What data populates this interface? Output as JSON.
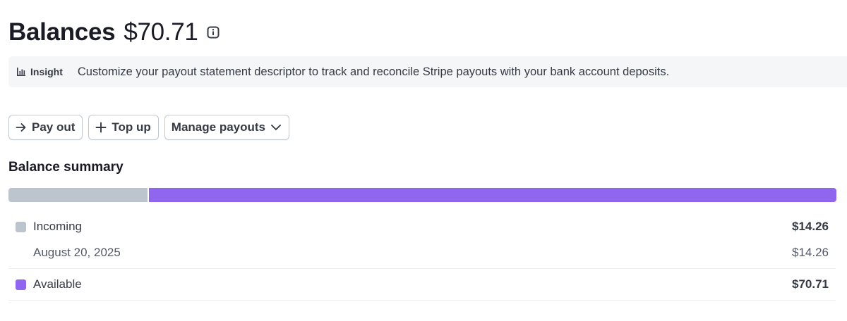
{
  "header": {
    "title": "Balances",
    "balance": "$70.71",
    "info_icon": "info-icon"
  },
  "insight": {
    "icon": "bar-chart-icon",
    "label": "Insight",
    "text": "Customize your payout statement descriptor to track and reconcile Stripe payouts with your bank account deposits."
  },
  "actions": {
    "pay_out": {
      "label": "Pay out",
      "icon": "arrow-right-icon"
    },
    "top_up": {
      "label": "Top up",
      "icon": "plus-icon"
    },
    "manage_payouts": {
      "label": "Manage payouts",
      "icon": "chevron-down-icon"
    }
  },
  "summary": {
    "title": "Balance summary",
    "incoming_fraction": 0.168,
    "available_fraction": 0.832,
    "incoming": {
      "label": "Incoming",
      "amount": "$14.26",
      "color": "#bcc4ce",
      "detail_date": "August 20, 2025",
      "detail_amount": "$14.26"
    },
    "available": {
      "label": "Available",
      "amount": "$70.71",
      "color": "#9066ee"
    }
  }
}
